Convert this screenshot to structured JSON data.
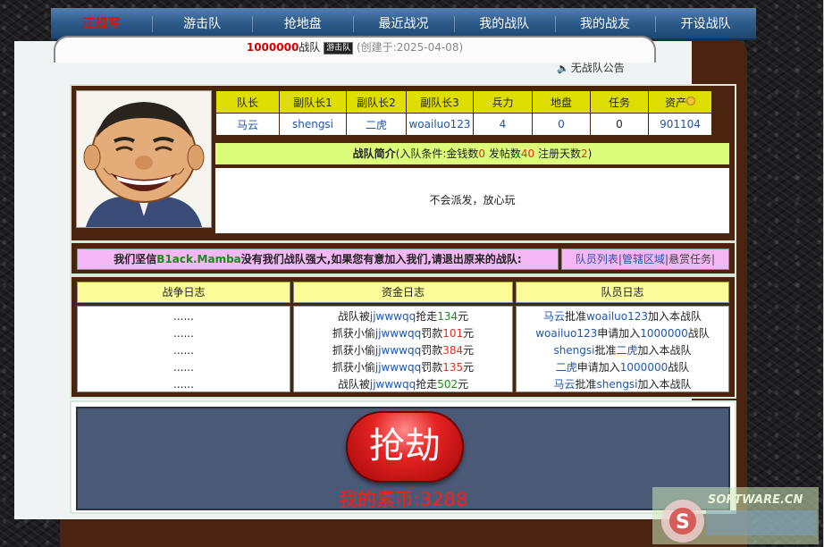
{
  "nav": {
    "items": [
      "正规军",
      "游击队",
      "抢地盘",
      "最近战况",
      "我的战队",
      "我的战友",
      "开设战队"
    ]
  },
  "title": {
    "team_name": "1000000",
    "team_suffix": "战队",
    "badge": "游击队",
    "created": "(创建于:2025-04-08)"
  },
  "notice": "无战队公告",
  "roles": {
    "headers": [
      "队长",
      "副队长1",
      "副队长2",
      "副队长3",
      "兵力",
      "地盘",
      "任务",
      "资产"
    ],
    "values": [
      "马云",
      "shengsi",
      "二虎",
      "woailuo123",
      "4",
      "0",
      "0",
      "901104"
    ]
  },
  "intro": {
    "title": "战队简介",
    "cond_prefix": "(入队条件:金钱数",
    "money": "0",
    "posts_label": " 发帖数",
    "posts": "40",
    "days_label": " 注册天数",
    "days": "2",
    "cond_suffix": ")",
    "body": "不会派发，放心玩"
  },
  "slogan": {
    "prefix": "我们坚信",
    "name": "B1ack.Mamba",
    "suffix": "没有我们战队强大,如果您有意加入我们,请退出原来的战队:"
  },
  "links": {
    "members": "队员列表",
    "area": "管辖区域",
    "bounty": "悬赏任务",
    "sep": "|"
  },
  "logs": {
    "war": {
      "title": "战争日志",
      "lines": [
        "......",
        "......",
        "......",
        "......",
        "......"
      ]
    },
    "funds": {
      "title": "资金日志",
      "lines": [
        {
          "pre": "战队被",
          "name": "jjwwwqq",
          "mid": "抢走",
          "num": "134",
          "post": "元"
        },
        {
          "pre": "抓获小偷",
          "name": "jjwwwqq",
          "mid": "罚款",
          "num": "101",
          "post": "元"
        },
        {
          "pre": "抓获小偷",
          "name": "jjwwwqq",
          "mid": "罚款",
          "num": "384",
          "post": "元"
        },
        {
          "pre": "抓获小偷",
          "name": "jjwwwqq",
          "mid": "罚款",
          "num": "135",
          "post": "元"
        },
        {
          "pre": "战队被",
          "name": "jjwwwqq",
          "mid": "抢走",
          "num": "502",
          "post": "元"
        }
      ]
    },
    "members": {
      "title": "队员日志",
      "lines": [
        {
          "a": "马云",
          "mid": "批准",
          "b": "woailuo123",
          "post": "加入本战队"
        },
        {
          "a": "woailuo123",
          "mid": "申请加入",
          "b": "1000000",
          "post": "战队"
        },
        {
          "a": "shengsi",
          "mid": "批准",
          "b": "二虎",
          "post": "加入本战队"
        },
        {
          "a": "二虎",
          "mid": "申请加入",
          "b": "1000000",
          "post": "战队"
        },
        {
          "a": "马云",
          "mid": "批准",
          "b": "shengsi",
          "post": "加入本战队"
        }
      ]
    }
  },
  "rob": {
    "button": "抢劫",
    "coins": "我的素币:3288"
  },
  "watermark": {
    "text": "SOFTWARE.CN",
    "logo": "S"
  },
  "colors": {
    "nav": "#2f5d8c",
    "frame": "#4a2410",
    "header_cell": "#dede00",
    "intro_bar": "#dbfd7a",
    "slogan_bg": "#f5b7f5",
    "log_head": "#fbfb97",
    "rob_panel": "#4a5976",
    "rob_button": "#e42222"
  }
}
